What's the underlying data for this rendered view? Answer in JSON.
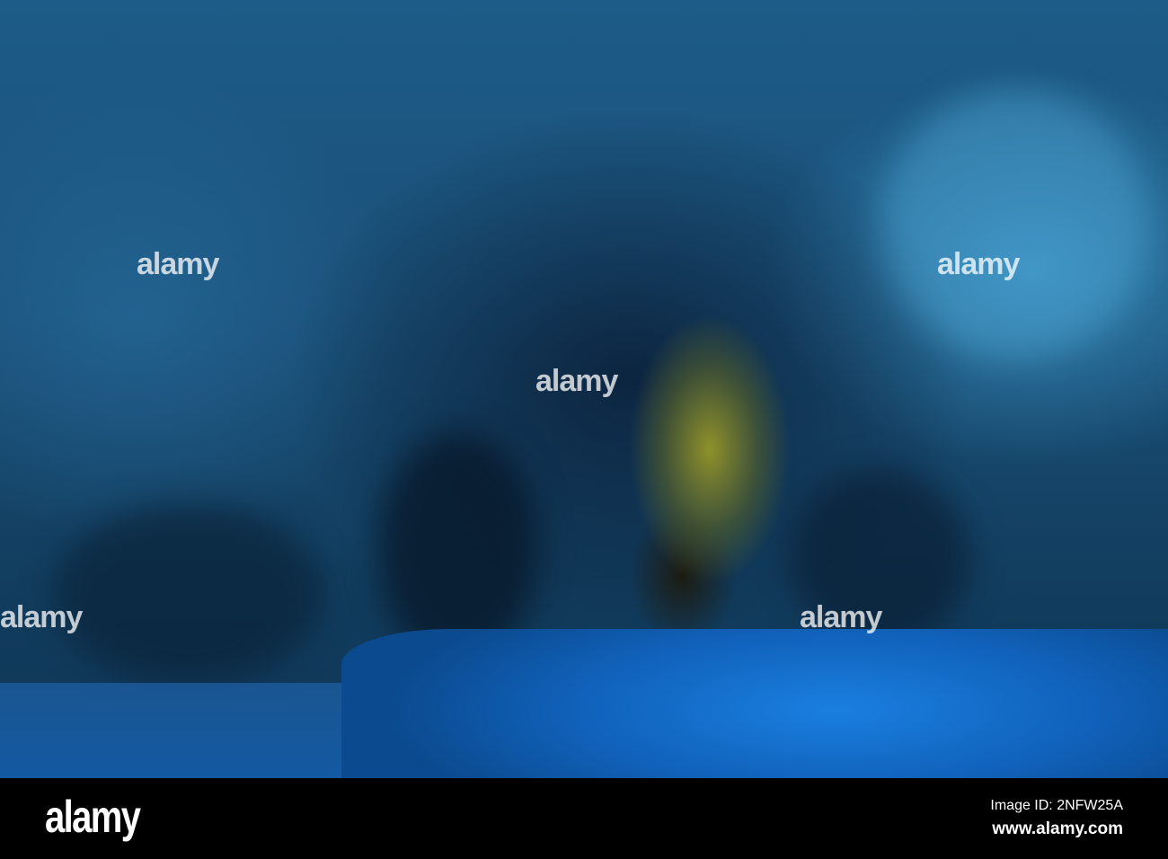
{
  "photo": {
    "subject": "Blue cave",
    "watermark_text": "alamy"
  },
  "footer": {
    "logo": "alamy",
    "image_id": "Image ID: 2NFW25A",
    "url": "www.alamy.com"
  }
}
